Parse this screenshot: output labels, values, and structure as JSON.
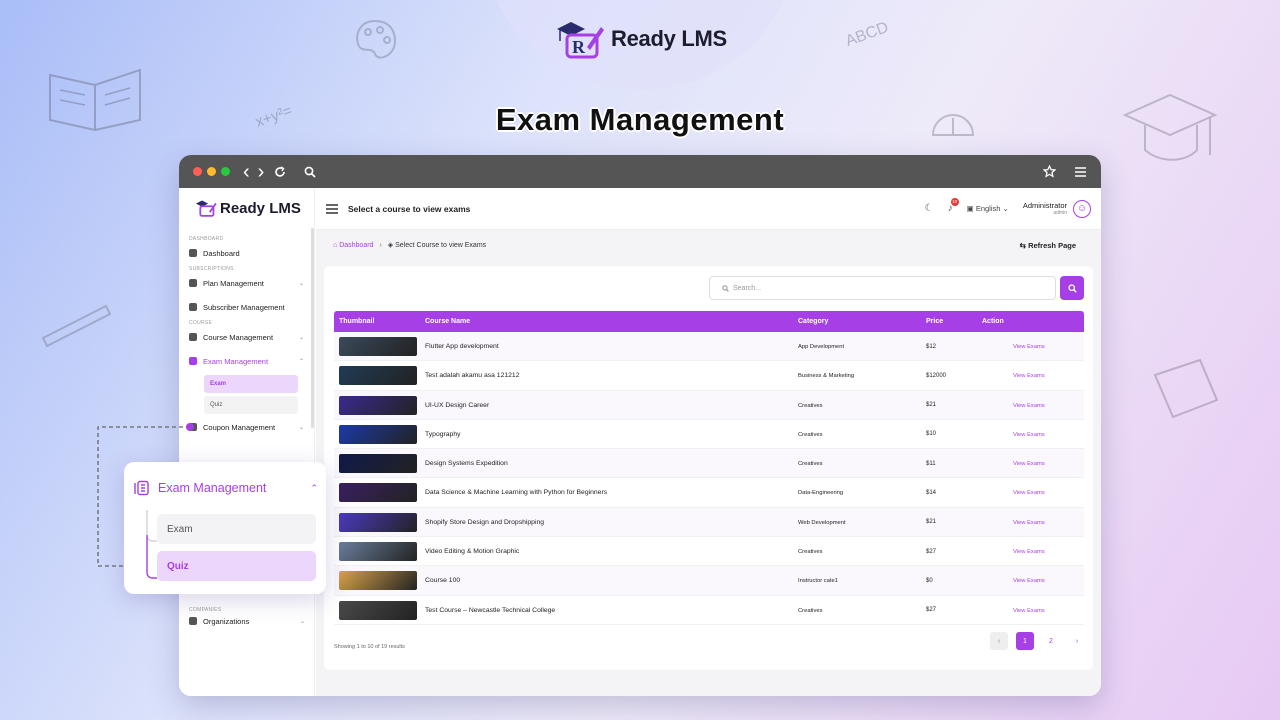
{
  "brand": {
    "name": "Ready LMS"
  },
  "hero": {
    "title": "Exam Management"
  },
  "browser": {
    "nav_back": "‹",
    "nav_forward": "›"
  },
  "sidebar": {
    "logo": "Ready LMS",
    "sections": {
      "dashboard": "DASHBOARD",
      "subscriptions": "SUBSCRIPTIONS",
      "course": "COURSE",
      "companies": "COMPANIES"
    },
    "items": {
      "dashboard": "Dashboard",
      "plan": "Plan Management",
      "subscriber": "Subscriber Management",
      "course": "Course Management",
      "exam": "Exam Management",
      "exam_sub": "Exam",
      "quiz_sub": "Quiz",
      "coupon": "Coupon Management",
      "organizations": "Organizations"
    }
  },
  "topbar": {
    "title": "Select a course to view exams",
    "notifications": "10",
    "language": "English",
    "user_name": "Administrator",
    "user_role": "admin"
  },
  "breadcrumb": {
    "home": "Dashboard",
    "current": "Select Course to view Exams",
    "refresh": "Refresh Page"
  },
  "search": {
    "placeholder": "Search..."
  },
  "table": {
    "headers": {
      "thumbnail": "Thumbnail",
      "name": "Course Name",
      "category": "Category",
      "price": "Price",
      "action": "Action"
    },
    "rows": [
      {
        "name": "Flutter App development",
        "category": "App Development",
        "price": "$12",
        "action": "View Exams",
        "thumb": "#3a4a5c"
      },
      {
        "name": "Test adalah akamu asa 121212",
        "category": "Business & Marketing",
        "price": "$12000",
        "action": "View Exams",
        "thumb": "#1f3c55"
      },
      {
        "name": "UI-UX Design Career",
        "category": "Creatives",
        "price": "$21",
        "action": "View Exams",
        "thumb": "#3b2a8f"
      },
      {
        "name": "Typography",
        "category": "Creatives",
        "price": "$10",
        "action": "View Exams",
        "thumb": "#1b3aa8"
      },
      {
        "name": "Design Systems Expedition",
        "category": "Creatives",
        "price": "$11",
        "action": "View Exams",
        "thumb": "#101a4a"
      },
      {
        "name": "Data Science & Machine Learning with Python for Beginners",
        "category": "Data-Engineering",
        "price": "$14",
        "action": "View Exams",
        "thumb": "#3a2060"
      },
      {
        "name": "Shopify Store Design and Dropshipping",
        "category": "Web Development",
        "price": "$21",
        "action": "View Exams",
        "thumb": "#4b3bc0"
      },
      {
        "name": "Video Editing & Motion Graphic",
        "category": "Creatives",
        "price": "$27",
        "action": "View Exams",
        "thumb": "#6a7f9c"
      },
      {
        "name": "Course 100",
        "category": "Instructor cate1",
        "price": "$0",
        "action": "View Exams",
        "thumb": "#d9a44a"
      },
      {
        "name": "Test Course – Newcastle Technical College",
        "category": "Creatives",
        "price": "$27",
        "action": "View Exams",
        "thumb": "#4a4a4a"
      }
    ]
  },
  "footer": {
    "showing": "Showing 1 to 10 of 19 results"
  },
  "pagination": {
    "prev": "‹",
    "pages": [
      "1",
      "2"
    ],
    "next": "›"
  },
  "callout": {
    "title": "Exam Management",
    "exam": "Exam",
    "quiz": "Quiz"
  },
  "colors": {
    "accent": "#a63fe6",
    "chrome": "#555555",
    "badge": "#e53935"
  }
}
